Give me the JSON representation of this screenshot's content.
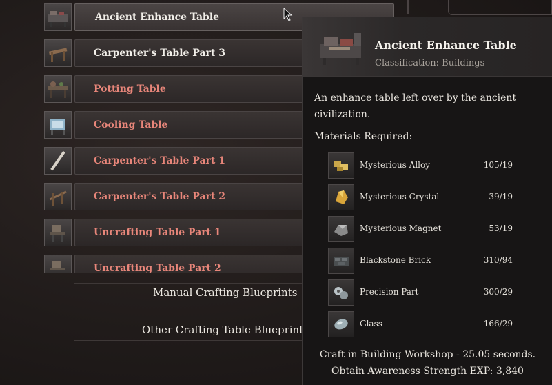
{
  "list": {
    "items": [
      {
        "label": "Ancient Enhance Table",
        "color": "white",
        "icon": "enhance-table-icon",
        "selected": true
      },
      {
        "label": "Carpenter's Table Part 3",
        "color": "white",
        "icon": "carpenter-table-icon"
      },
      {
        "label": "Potting Table",
        "color": "red",
        "icon": "potting-table-icon"
      },
      {
        "label": "Cooling Table",
        "color": "red",
        "icon": "cooling-table-icon"
      },
      {
        "label": "Carpenter's Table Part 1",
        "color": "red",
        "icon": "plank-icon"
      },
      {
        "label": "Carpenter's Table Part 2",
        "color": "red",
        "icon": "carpenter-frame-icon"
      },
      {
        "label": "Uncrafting Table Part 1",
        "color": "red",
        "icon": "uncrafting-table-icon"
      },
      {
        "label": "Uncrafting Table Part 2",
        "color": "red",
        "icon": "uncrafting-table-icon"
      }
    ]
  },
  "categories": {
    "manual": "Manual Crafting Blueprints",
    "other": "Other Crafting Table Blueprints"
  },
  "tooltip": {
    "title": "Ancient Enhance Table",
    "classification": "Classification: Buildings",
    "description": "An enhance table left over by the ancient civilization.",
    "materials_heading": "Materials Required:",
    "materials": [
      {
        "name": "Mysterious Alloy",
        "count": "105/19",
        "icon": "alloy-icon"
      },
      {
        "name": "Mysterious Crystal",
        "count": "39/19",
        "icon": "crystal-icon"
      },
      {
        "name": "Mysterious Magnet",
        "count": "53/19",
        "icon": "magnet-icon"
      },
      {
        "name": "Blackstone Brick",
        "count": "310/94",
        "icon": "brick-icon"
      },
      {
        "name": "Precision Part",
        "count": "300/29",
        "icon": "part-icon"
      },
      {
        "name": "Glass",
        "count": "166/29",
        "icon": "glass-icon"
      }
    ],
    "craft_line": "Craft in Building Workshop - 25.05 seconds.",
    "exp_line": "Obtain Awareness Strength EXP: 3,840"
  },
  "colors": {
    "available": "#f2efe9",
    "unavailable": "#e8867a",
    "background": "#201b1a",
    "tooltip_bg": "#171515"
  }
}
